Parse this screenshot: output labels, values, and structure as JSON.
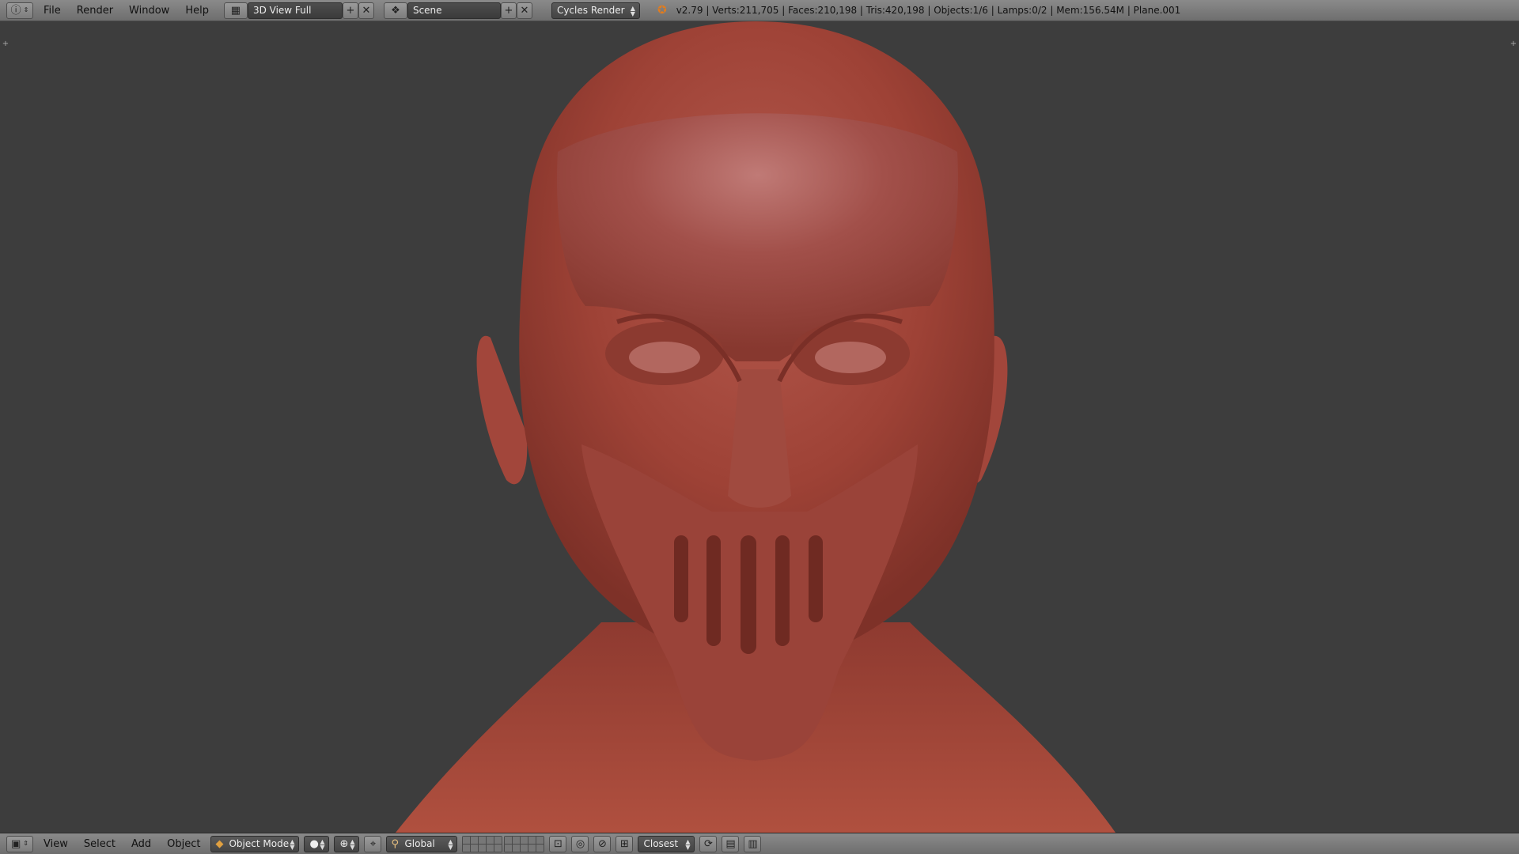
{
  "topbar": {
    "info_icon": "info-icon",
    "menus": [
      "File",
      "Render",
      "Window",
      "Help"
    ],
    "screen_layout": "3D View Full",
    "scene": "Scene",
    "render_engine": "Cycles Render",
    "stats": "v2.79 | Verts:211,705 | Faces:210,198 | Tris:420,198 | Objects:1/6 | Lamps:0/2 | Mem:156.54M | Plane.001"
  },
  "bottombar": {
    "editor_icon": "view3d-icon",
    "menus": [
      "View",
      "Select",
      "Add",
      "Object"
    ],
    "mode": "Object Mode",
    "transform_orientation": "Global",
    "snap_target": "Closest"
  },
  "viewport": {
    "background": "#3d3d3d",
    "model_color": "#a8483c",
    "subject": "sculpted head with mask"
  }
}
